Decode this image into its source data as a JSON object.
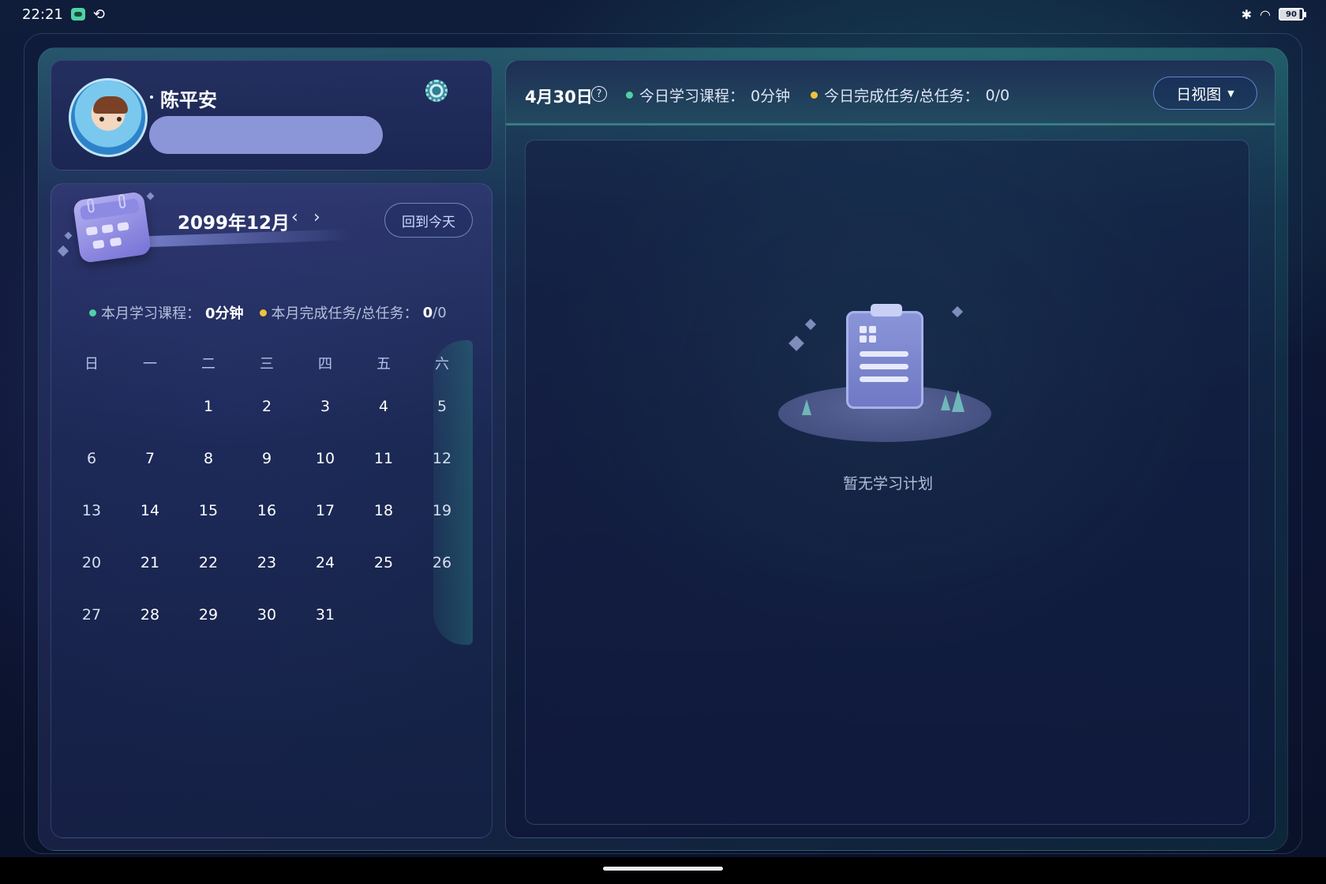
{
  "status_bar": {
    "time": "22:21",
    "battery": "90",
    "icons": [
      "app-notification-icon",
      "sync-icon",
      "bluetooth-icon",
      "wifi-icon",
      "battery-icon"
    ]
  },
  "profile": {
    "name": "陈平安",
    "settings_icon": "settings-icon"
  },
  "calendar": {
    "month_title": "2099年12月",
    "prev_symbol": "‹",
    "next_symbol": "›",
    "today_button": "回到今天",
    "stats": {
      "course_label": "本月学习课程：",
      "course_value": "0分钟",
      "task_label": "本月完成任务/总任务：",
      "task_done": "0",
      "task_total": "/0"
    },
    "weekdays": [
      "日",
      "一",
      "二",
      "三",
      "四",
      "五",
      "六"
    ],
    "weeks": [
      [
        "",
        "",
        "1",
        "2",
        "3",
        "4",
        "5"
      ],
      [
        "6",
        "7",
        "8",
        "9",
        "10",
        "11",
        "12"
      ],
      [
        "13",
        "14",
        "15",
        "16",
        "17",
        "18",
        "19"
      ],
      [
        "20",
        "21",
        "22",
        "23",
        "24",
        "25",
        "26"
      ],
      [
        "27",
        "28",
        "29",
        "30",
        "31",
        "",
        ""
      ]
    ]
  },
  "plan": {
    "date": "4月30日",
    "help_symbol": "?",
    "course_label": "今日学习课程：",
    "course_value": "0分钟",
    "task_label": "今日完成任务/总任务：",
    "task_value": "0/0",
    "view_select": "日视图",
    "empty_text": "暂无学习计划"
  },
  "colors": {
    "accent_green": "#4fd1a5",
    "accent_yellow": "#f0c23b",
    "background": "#0c1532"
  }
}
